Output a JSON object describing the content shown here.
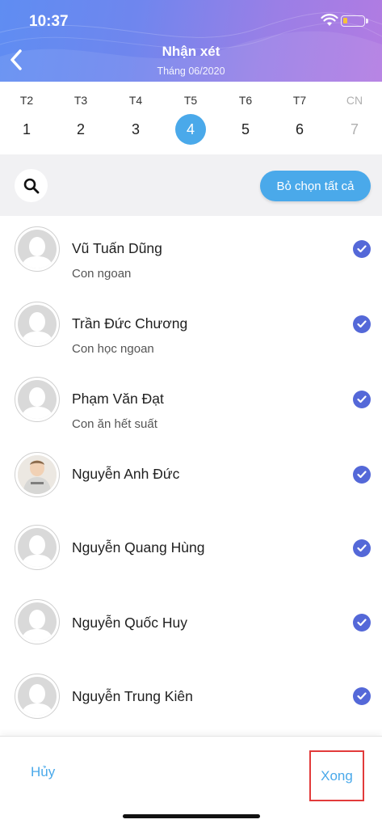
{
  "status_bar": {
    "time": "10:37"
  },
  "header": {
    "title": "Nhận xét",
    "subtitle": "Tháng 06/2020"
  },
  "week": [
    {
      "day": "T2",
      "date": "1",
      "state": "normal"
    },
    {
      "day": "T3",
      "date": "2",
      "state": "normal"
    },
    {
      "day": "T4",
      "date": "3",
      "state": "normal"
    },
    {
      "day": "T5",
      "date": "4",
      "state": "selected"
    },
    {
      "day": "T6",
      "date": "5",
      "state": "normal"
    },
    {
      "day": "T7",
      "date": "6",
      "state": "normal"
    },
    {
      "day": "CN",
      "date": "7",
      "state": "disabled"
    }
  ],
  "toolbar": {
    "deselect_all_label": "Bỏ chọn tất cả"
  },
  "students": [
    {
      "name": "Vũ Tuấn Dũng",
      "note": "Con ngoan",
      "checked": true,
      "avatar": "placeholder"
    },
    {
      "name": "Trần Đức Chương",
      "note": "Con học ngoan",
      "checked": true,
      "avatar": "placeholder"
    },
    {
      "name": "Phạm Văn Đạt",
      "note": "Con ăn hết suất",
      "checked": true,
      "avatar": "placeholder"
    },
    {
      "name": "Nguyễn Anh Đức",
      "note": "",
      "checked": true,
      "avatar": "photo"
    },
    {
      "name": "Nguyễn Quang Hùng",
      "note": "",
      "checked": true,
      "avatar": "placeholder"
    },
    {
      "name": "Nguyễn Quốc Huy",
      "note": "",
      "checked": true,
      "avatar": "placeholder"
    },
    {
      "name": "Nguyễn Trung Kiên",
      "note": "",
      "checked": true,
      "avatar": "placeholder"
    }
  ],
  "footer": {
    "cancel_label": "Hủy",
    "done_label": "Xong"
  },
  "colors": {
    "accent": "#4aa9ea",
    "check": "#5468d8",
    "highlight_border": "#e23b3b"
  }
}
